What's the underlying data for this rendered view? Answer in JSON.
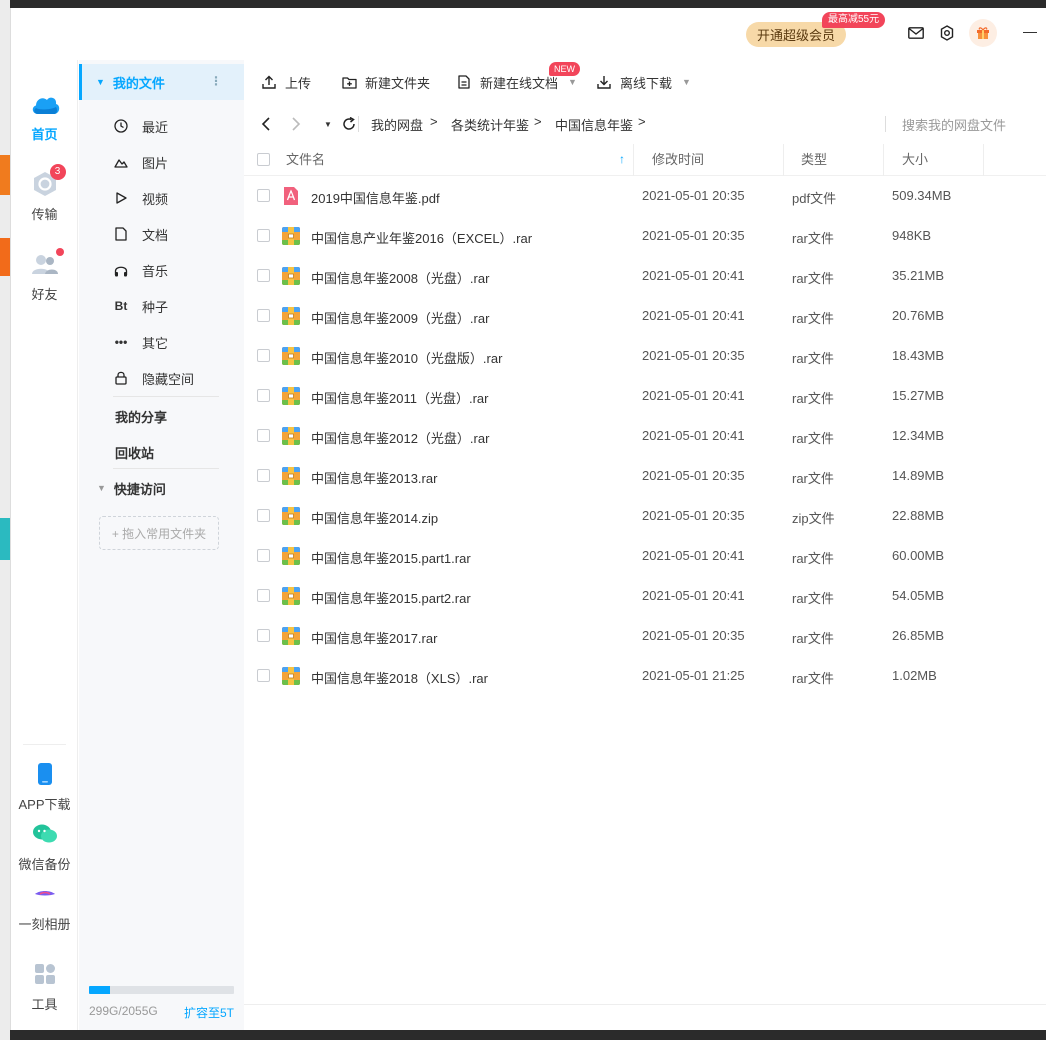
{
  "titlebar": {
    "vip_button": "开通超级会员",
    "vip_badge": "最高减55元",
    "icons": [
      "mail-icon",
      "settings-icon",
      "gift-icon",
      "minimize-icon"
    ]
  },
  "rail": {
    "home": "首页",
    "transfer": "传输",
    "transfer_badge": "3",
    "friends": "好友",
    "app_download": "APP下载",
    "wechat_backup": "微信备份",
    "album": "一刻相册",
    "tools": "工具"
  },
  "nav": {
    "my_files": "我的文件",
    "items": [
      {
        "label": "最近",
        "icon": "clock-icon"
      },
      {
        "label": "图片",
        "icon": "image-icon"
      },
      {
        "label": "视频",
        "icon": "play-icon"
      },
      {
        "label": "文档",
        "icon": "document-icon"
      },
      {
        "label": "音乐",
        "icon": "headphones-icon"
      },
      {
        "label": "种子",
        "icon": "bt-icon"
      },
      {
        "label": "其它",
        "icon": "more-icon"
      },
      {
        "label": "隐藏空间",
        "icon": "lock-icon"
      }
    ],
    "my_share": "我的分享",
    "recycle_bin": "回收站",
    "quick_access": "快捷访问",
    "drop_hint": "+ 拖入常用文件夹",
    "quota_text": "299G/2055G",
    "quota_fraction": 0.145,
    "expand_link": "扩容至5T"
  },
  "toolbar": {
    "upload": "上传",
    "new_folder": "新建文件夹",
    "new_online_doc": "新建在线文档",
    "new_badge": "NEW",
    "offline_download": "离线下载"
  },
  "breadcrumb": {
    "items": [
      "我的网盘",
      "各类统计年鉴",
      "中国信息年鉴"
    ],
    "separator": ">",
    "search_placeholder": "搜索我的网盘文件"
  },
  "table": {
    "headers": {
      "name": "文件名",
      "modified": "修改时间",
      "type": "类型",
      "size": "大小"
    },
    "rows": [
      {
        "name": "2019中国信息年鉴.pdf",
        "modified": "2021-05-01 20:35",
        "type": "pdf文件",
        "size": "509.34MB",
        "kind": "pdf"
      },
      {
        "name": "中国信息产业年鉴2016（EXCEL）.rar",
        "modified": "2021-05-01 20:35",
        "type": "rar文件",
        "size": "948KB",
        "kind": "archive"
      },
      {
        "name": "中国信息年鉴2008（光盘）.rar",
        "modified": "2021-05-01 20:41",
        "type": "rar文件",
        "size": "35.21MB",
        "kind": "archive"
      },
      {
        "name": "中国信息年鉴2009（光盘）.rar",
        "modified": "2021-05-01 20:41",
        "type": "rar文件",
        "size": "20.76MB",
        "kind": "archive"
      },
      {
        "name": "中国信息年鉴2010（光盘版）.rar",
        "modified": "2021-05-01 20:35",
        "type": "rar文件",
        "size": "18.43MB",
        "kind": "archive"
      },
      {
        "name": "中国信息年鉴2011（光盘）.rar",
        "modified": "2021-05-01 20:41",
        "type": "rar文件",
        "size": "15.27MB",
        "kind": "archive"
      },
      {
        "name": "中国信息年鉴2012（光盘）.rar",
        "modified": "2021-05-01 20:41",
        "type": "rar文件",
        "size": "12.34MB",
        "kind": "archive"
      },
      {
        "name": "中国信息年鉴2013.rar",
        "modified": "2021-05-01 20:35",
        "type": "rar文件",
        "size": "14.89MB",
        "kind": "archive"
      },
      {
        "name": "中国信息年鉴2014.zip",
        "modified": "2021-05-01 20:35",
        "type": "zip文件",
        "size": "22.88MB",
        "kind": "archive"
      },
      {
        "name": "中国信息年鉴2015.part1.rar",
        "modified": "2021-05-01 20:41",
        "type": "rar文件",
        "size": "60.00MB",
        "kind": "archive"
      },
      {
        "name": "中国信息年鉴2015.part2.rar",
        "modified": "2021-05-01 20:41",
        "type": "rar文件",
        "size": "54.05MB",
        "kind": "archive"
      },
      {
        "name": "中国信息年鉴2017.rar",
        "modified": "2021-05-01 20:35",
        "type": "rar文件",
        "size": "26.85MB",
        "kind": "archive"
      },
      {
        "name": "中国信息年鉴2018（XLS）.rar",
        "modified": "2021-05-01 21:25",
        "type": "rar文件",
        "size": "1.02MB",
        "kind": "archive"
      }
    ]
  },
  "colors": {
    "accent": "#06a7ff",
    "badge": "#f2455a",
    "vip": "#f7d9a8"
  }
}
